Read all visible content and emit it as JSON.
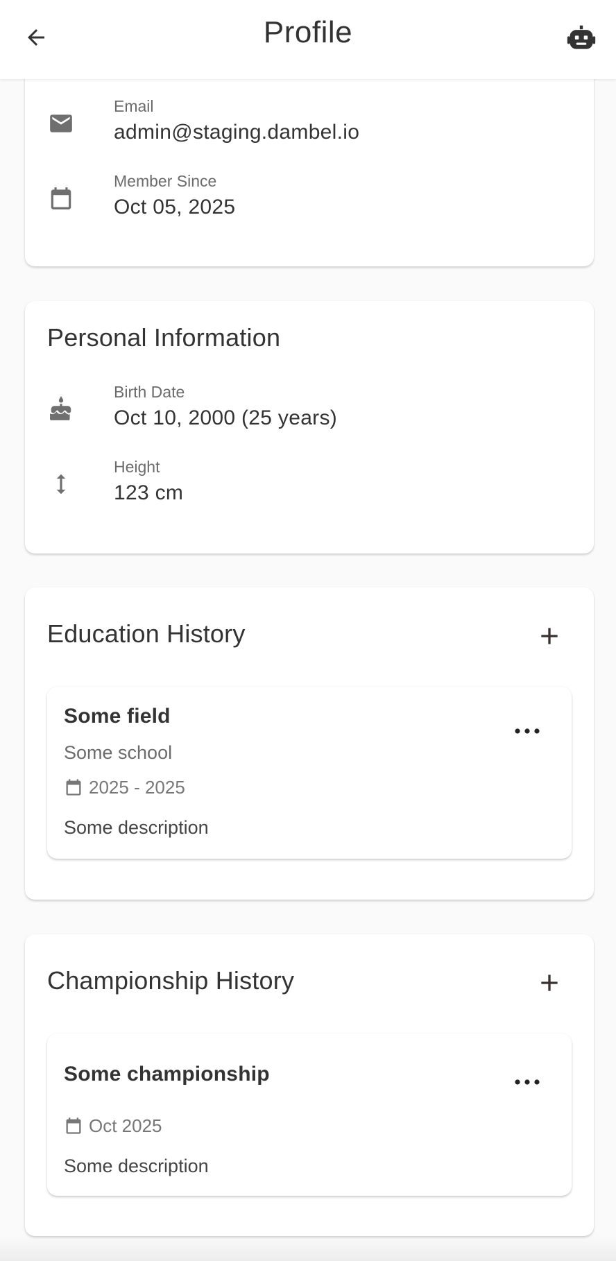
{
  "appbar": {
    "title": "Profile",
    "back_icon": "arrow-back-icon",
    "assistant_icon": "robot-icon"
  },
  "contact": {
    "email": {
      "label": "Email",
      "value": "admin@staging.dambel.io",
      "icon": "mail-icon"
    },
    "member_since": {
      "label": "Member Since",
      "value": "Oct 05, 2025",
      "icon": "calendar-icon"
    }
  },
  "personal": {
    "title": "Personal Information",
    "birth_date": {
      "label": "Birth Date",
      "value": "Oct 10, 2000 (25 years)",
      "icon": "cake-icon"
    },
    "height": {
      "label": "Height",
      "value": "123 cm",
      "icon": "vertical-arrows-icon"
    }
  },
  "education": {
    "title": "Education History",
    "add_icon": "plus-icon",
    "items": [
      {
        "field": "Some field",
        "school": "Some school",
        "years": "2025 - 2025",
        "description": "Some description"
      }
    ]
  },
  "championship": {
    "title": "Championship History",
    "add_icon": "plus-icon",
    "items": [
      {
        "name": "Some championship",
        "date": "Oct 2025",
        "description": "Some description"
      }
    ]
  },
  "colors": {
    "icon_gray": "#6f6f6f",
    "text_dark": "#333333",
    "text_muted": "#6b6b6b",
    "card_bg": "#ffffff",
    "page_bg": "#fafafa"
  }
}
